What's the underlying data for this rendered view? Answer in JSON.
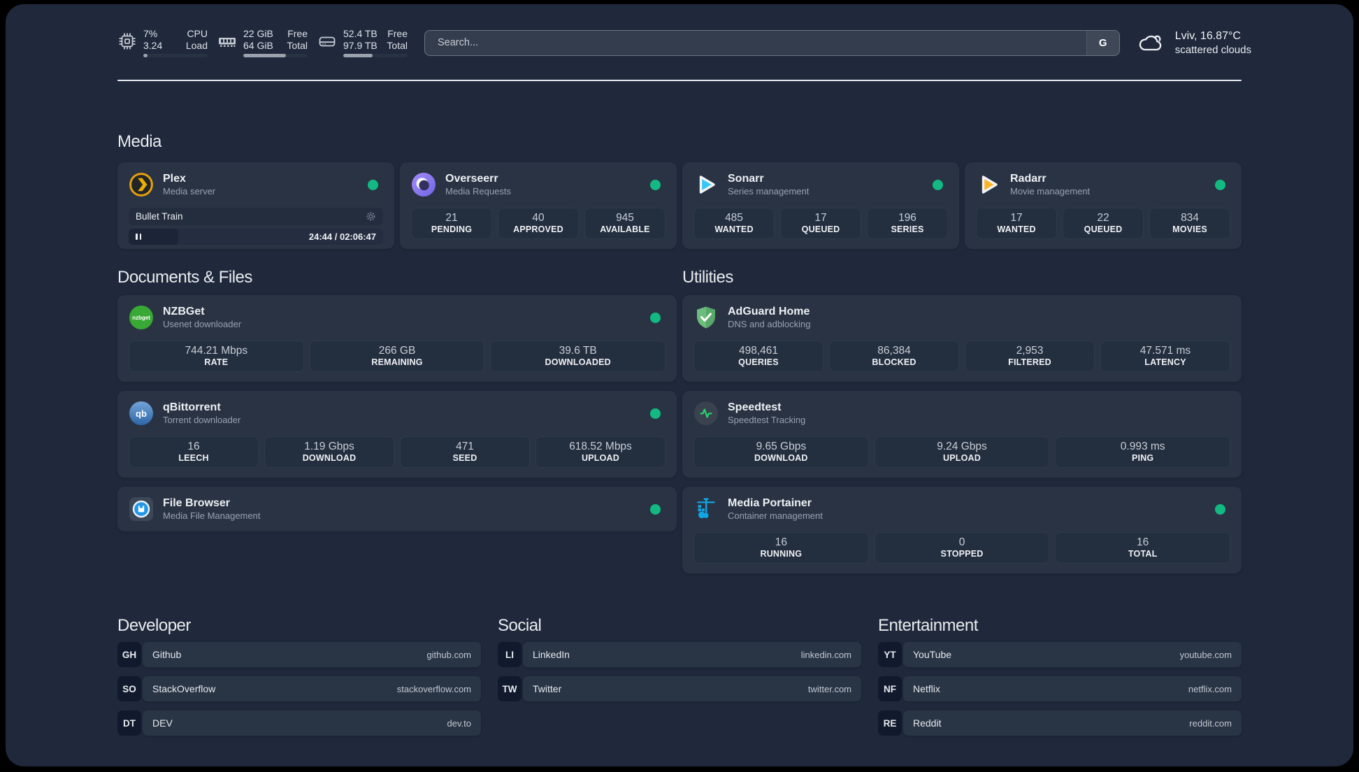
{
  "topbar": {
    "system_stats": [
      {
        "id": "cpu",
        "icon": "cpu-chip",
        "line1_value": "7%",
        "line2_value": "3.24",
        "line1_label": "CPU",
        "line2_label": "Load",
        "progress_pct": 7
      },
      {
        "id": "memory",
        "icon": "ram",
        "line1_value": "22 GiB",
        "line2_value": "64 GiB",
        "line1_label": "Free",
        "line2_label": "Total",
        "progress_pct": 66
      },
      {
        "id": "disk",
        "icon": "hdd",
        "line1_value": "52.4 TB",
        "line2_value": "97.9 TB",
        "line1_label": "Free",
        "line2_label": "Total",
        "progress_pct": 46
      }
    ],
    "search": {
      "placeholder": "Search...",
      "button_label": "G"
    },
    "weather": {
      "location_temperature": "Lviv, 16.87°C",
      "condition": "scattered clouds"
    }
  },
  "sections": {
    "media": {
      "title": "Media",
      "apps": [
        {
          "id": "plex",
          "name": "Plex",
          "description": "Media server",
          "icon": "plex",
          "online": true,
          "now_playing": {
            "title": "Bullet Train",
            "time": "24:44 / 02:06:47",
            "progress_pct": 19.5
          }
        },
        {
          "id": "overseerr",
          "name": "Overseerr",
          "description": "Media Requests",
          "icon": "overseerr",
          "online": true,
          "stats": [
            {
              "value": "21",
              "label": "PENDING"
            },
            {
              "value": "40",
              "label": "APPROVED"
            },
            {
              "value": "945",
              "label": "AVAILABLE"
            }
          ]
        },
        {
          "id": "sonarr",
          "name": "Sonarr",
          "description": "Series management",
          "icon": "sonarr",
          "online": true,
          "stats": [
            {
              "value": "485",
              "label": "WANTED"
            },
            {
              "value": "17",
              "label": "QUEUED"
            },
            {
              "value": "196",
              "label": "SERIES"
            }
          ]
        },
        {
          "id": "radarr",
          "name": "Radarr",
          "description": "Movie management",
          "icon": "radarr",
          "online": true,
          "stats": [
            {
              "value": "17",
              "label": "WANTED"
            },
            {
              "value": "22",
              "label": "QUEUED"
            },
            {
              "value": "834",
              "label": "MOVIES"
            }
          ]
        }
      ]
    },
    "documents": {
      "title": "Documents & Files",
      "apps": [
        {
          "id": "nzbget",
          "name": "NZBGet",
          "description": "Usenet downloader",
          "icon": "nzbget",
          "online": true,
          "stats": [
            {
              "value": "744.21 Mbps",
              "label": "RATE"
            },
            {
              "value": "266 GB",
              "label": "REMAINING"
            },
            {
              "value": "39.6 TB",
              "label": "DOWNLOADED"
            }
          ]
        },
        {
          "id": "qbittorrent",
          "name": "qBittorrent",
          "description": "Torrent downloader",
          "icon": "qbittorrent",
          "online": true,
          "stats": [
            {
              "value": "16",
              "label": "LEECH"
            },
            {
              "value": "1.19 Gbps",
              "label": "DOWNLOAD"
            },
            {
              "value": "471",
              "label": "SEED"
            },
            {
              "value": "618.52 Mbps",
              "label": "UPLOAD"
            }
          ]
        },
        {
          "id": "filebrowser",
          "name": "File Browser",
          "description": "Media File Management",
          "icon": "filebrowser",
          "online": true,
          "slim": true
        }
      ]
    },
    "utilities": {
      "title": "Utilities",
      "apps": [
        {
          "id": "adguard",
          "name": "AdGuard Home",
          "description": "DNS and adblocking",
          "icon": "adguard",
          "online": false,
          "stats": [
            {
              "value": "498,461",
              "label": "QUERIES"
            },
            {
              "value": "86,384",
              "label": "BLOCKED"
            },
            {
              "value": "2,953",
              "label": "FILTERED"
            },
            {
              "value": "47.571 ms",
              "label": "LATENCY"
            }
          ]
        },
        {
          "id": "speedtest",
          "name": "Speedtest",
          "description": "Speedtest Tracking",
          "icon": "speedtest",
          "online": false,
          "stats": [
            {
              "value": "9.65 Gbps",
              "label": "DOWNLOAD"
            },
            {
              "value": "9.24 Gbps",
              "label": "UPLOAD"
            },
            {
              "value": "0.993 ms",
              "label": "PING"
            }
          ]
        },
        {
          "id": "portainer",
          "name": "Media Portainer",
          "description": "Container management",
          "icon": "portainer",
          "online": true,
          "stats": [
            {
              "value": "16",
              "label": "RUNNING"
            },
            {
              "value": "0",
              "label": "STOPPED"
            },
            {
              "value": "16",
              "label": "TOTAL"
            }
          ]
        }
      ]
    }
  },
  "link_sections": [
    {
      "id": "developer",
      "title": "Developer",
      "links": [
        {
          "abbr": "GH",
          "name": "Github",
          "url": "github.com"
        },
        {
          "abbr": "SO",
          "name": "StackOverflow",
          "url": "stackoverflow.com"
        },
        {
          "abbr": "DT",
          "name": "DEV",
          "url": "dev.to"
        }
      ]
    },
    {
      "id": "social",
      "title": "Social",
      "links": [
        {
          "abbr": "LI",
          "name": "LinkedIn",
          "url": "linkedin.com"
        },
        {
          "abbr": "TW",
          "name": "Twitter",
          "url": "twitter.com"
        }
      ]
    },
    {
      "id": "entertainment",
      "title": "Entertainment",
      "links": [
        {
          "abbr": "YT",
          "name": "YouTube",
          "url": "youtube.com"
        },
        {
          "abbr": "NF",
          "name": "Netflix",
          "url": "netflix.com"
        },
        {
          "abbr": "RE",
          "name": "Reddit",
          "url": "reddit.com"
        }
      ]
    }
  ],
  "colors": {
    "status_online": "#12ba81",
    "page_background": "#1f293b",
    "card_background": "#293344"
  }
}
